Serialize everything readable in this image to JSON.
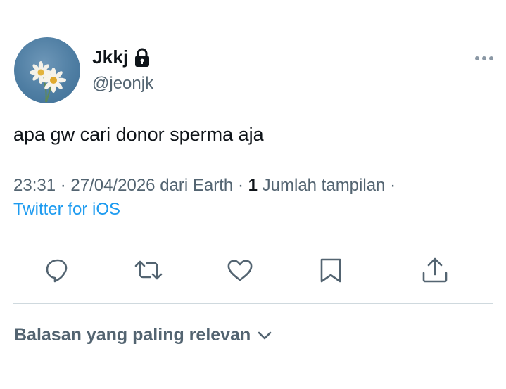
{
  "user": {
    "name": "Jkkj",
    "handle": "@jeonjk"
  },
  "tweet": {
    "text": "apa gw cari donor sperma aja",
    "time": "23:31",
    "date": "27/04/2026",
    "location": "dari Earth",
    "views_count": "1",
    "views_label": "Jumlah tampilan",
    "source": "Twitter for iOS"
  },
  "replies_sort": {
    "label": "Balasan yang paling relevan"
  },
  "colors": {
    "text_primary": "#0f1419",
    "text_secondary": "#536471",
    "link": "#1d9bf0",
    "divider": "#cfd9de"
  },
  "icons": [
    "avatar-image",
    "lock-icon",
    "more-icon",
    "reply-icon",
    "retweet-icon",
    "like-icon",
    "bookmark-icon",
    "share-icon",
    "chevron-down-icon"
  ]
}
